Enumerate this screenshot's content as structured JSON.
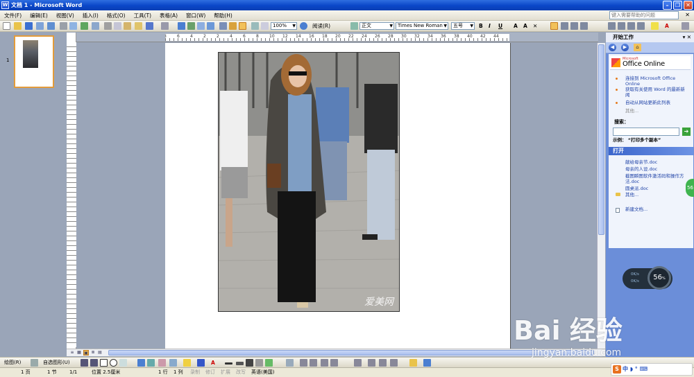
{
  "window": {
    "title": "文档 1 - Microsoft Word"
  },
  "menu": {
    "items": [
      "文件(F)",
      "编辑(E)",
      "视图(V)",
      "插入(I)",
      "格式(O)",
      "工具(T)",
      "表格(A)",
      "窗口(W)",
      "帮助(H)"
    ],
    "help_placeholder": "键入需要帮助的问题"
  },
  "toolbar": {
    "zoom": "100%",
    "read_label": "阅读(R)",
    "style": "正文",
    "font": "Times New Roman",
    "size": "五号"
  },
  "ruler": {
    "h_marks": [
      "8",
      "6",
      "4",
      "2",
      "2",
      "4",
      "6",
      "8",
      "10",
      "12",
      "14",
      "16",
      "18",
      "20",
      "22",
      "24",
      "26",
      "28",
      "30",
      "32",
      "34",
      "36",
      "38",
      "40",
      "42",
      "44"
    ]
  },
  "thumbnails": {
    "page_no": "1"
  },
  "photo": {
    "watermark": "爱美网"
  },
  "taskpane": {
    "title": "开始工作",
    "online_logo": "Office Online",
    "online_links": [
      "连接到 Microsoft Office Online",
      "获取有关使用 Word 的最新新闻",
      "自动从网站更新此列表"
    ],
    "more": "其他...",
    "search_label": "搜索：",
    "example": "示例：  “打印多个副本”",
    "open_header": "打开",
    "open_files": [
      "献给母亲节.doc",
      "母亲的人设.doc",
      "截图瞬图软件激活码和操作方法.doc",
      "圆桌派.doc"
    ],
    "open_more": "其他...",
    "new_doc": "新建文档..."
  },
  "drawbar": {
    "draw": "绘图(R)",
    "autoshape": "自选图形(U)"
  },
  "status": {
    "page": "1 页",
    "section": "1 节",
    "pages": "1/1",
    "position": "位置 2.5厘米",
    "line": "1 行",
    "col": "1 列",
    "rec": "录制",
    "trk": "修订",
    "ext": "扩展",
    "ovr": "改写",
    "lang": "英语(美国)"
  },
  "widgets": {
    "net_value": "56",
    "net_unit": "%",
    "net_up": "0K/s",
    "net_down": "0K/s",
    "green_value": "56",
    "baidu_text": "Bai 经验",
    "baidu_url": "jingyan.baidu.com",
    "tray_text": "中 ◗ ° ⌨"
  }
}
